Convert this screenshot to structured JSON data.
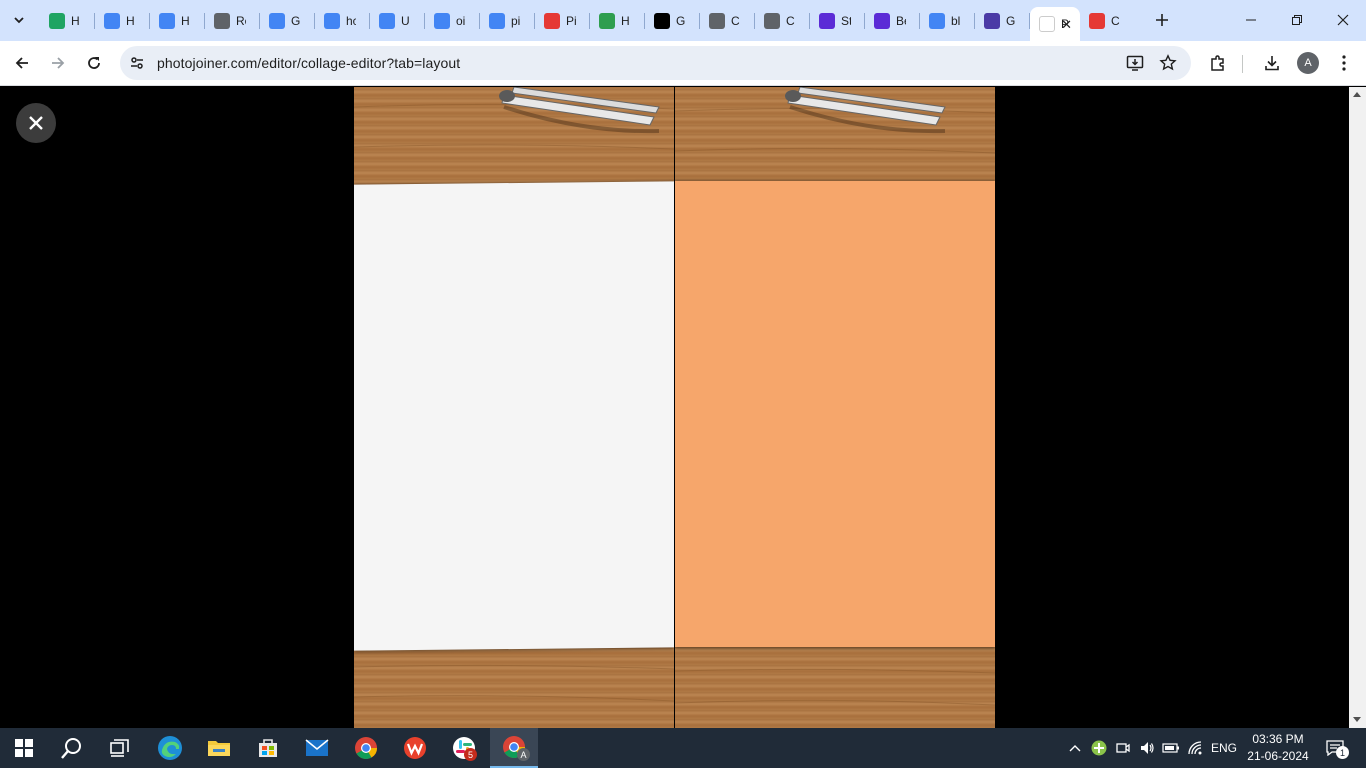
{
  "browser": {
    "tabs": [
      {
        "title": "H",
        "icon": "google-drive-icon",
        "color": "#1fa463"
      },
      {
        "title": "H",
        "icon": "google-docs-icon",
        "color": "#4285f4"
      },
      {
        "title": "H",
        "icon": "google-docs-icon",
        "color": "#4285f4"
      },
      {
        "title": "Re",
        "icon": "globe-icon",
        "color": "#5f6368"
      },
      {
        "title": "G",
        "icon": "google-icon",
        "color": "#4285f4"
      },
      {
        "title": "hc",
        "icon": "google-icon",
        "color": "#4285f4"
      },
      {
        "title": "U",
        "icon": "google-docs-icon",
        "color": "#4285f4"
      },
      {
        "title": "oi",
        "icon": "google-icon",
        "color": "#4285f4"
      },
      {
        "title": "pi",
        "icon": "google-icon",
        "color": "#4285f4"
      },
      {
        "title": "Pi",
        "icon": "red-tree-icon",
        "color": "#e53935"
      },
      {
        "title": "H",
        "icon": "px-icon",
        "color": "#2e9e4f"
      },
      {
        "title": "G",
        "icon": "chatgpt-icon",
        "color": "#000000"
      },
      {
        "title": "C",
        "icon": "chatgpt-icon",
        "color": "#5f6368"
      },
      {
        "title": "C",
        "icon": "chatgpt-icon",
        "color": "#5f6368"
      },
      {
        "title": "St",
        "icon": "purple-app-icon",
        "color": "#5b2bd6"
      },
      {
        "title": "Be",
        "icon": "purple-app-icon",
        "color": "#5b2bd6"
      },
      {
        "title": "bl",
        "icon": "google-icon",
        "color": "#4285f4"
      },
      {
        "title": "G",
        "icon": "wide-purple-icon",
        "color": "#4a3aa6"
      },
      {
        "title": "Pl",
        "icon": "photojoiner-icon",
        "color": "#ffffff",
        "active": true
      },
      {
        "title": "C",
        "icon": "wrench-icon",
        "color": "#e53935"
      }
    ],
    "url": "photojoiner.com/editor/collage-editor?tab=layout",
    "profile_initial": "A"
  },
  "taskbar": {
    "apps": [
      {
        "name": "search",
        "icon": "search-icon"
      },
      {
        "name": "task-view",
        "icon": "task-view-icon"
      },
      {
        "name": "edge",
        "icon": "edge-icon"
      },
      {
        "name": "file-explorer",
        "icon": "folder-icon"
      },
      {
        "name": "store",
        "icon": "store-icon"
      },
      {
        "name": "mail",
        "icon": "mail-icon"
      },
      {
        "name": "chrome",
        "icon": "chrome-icon"
      },
      {
        "name": "wps",
        "icon": "wps-icon"
      },
      {
        "name": "slack",
        "icon": "slack-icon",
        "badge": "5"
      },
      {
        "name": "chrome-profile",
        "icon": "chrome-icon",
        "active": true
      }
    ],
    "language": "ENG",
    "time": "03:36 PM",
    "date": "21-06-2024",
    "notification_count": "1"
  },
  "colors": {
    "tab_strip": "#d3e3fd",
    "paper_left": "#f5f5f5",
    "paper_right": "#f6a66b",
    "wood": "#a9733f"
  }
}
